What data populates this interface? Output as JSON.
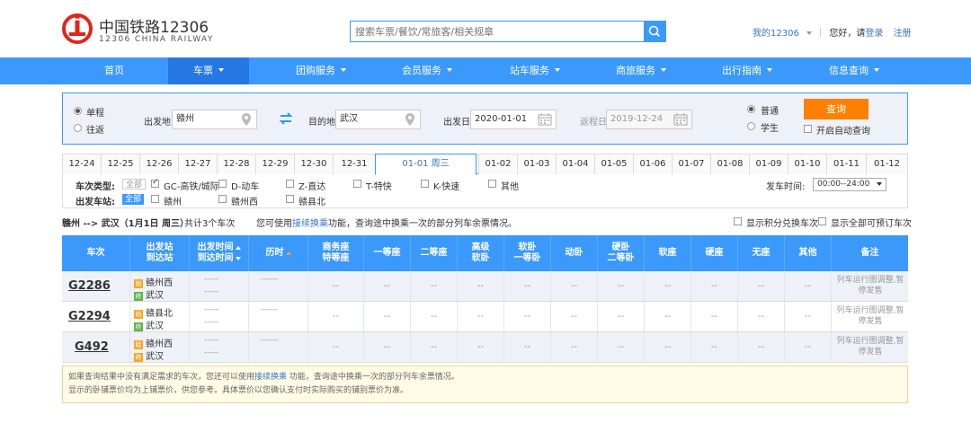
{
  "brand": {
    "name_cn": "中国铁路12306",
    "name_en": "12306 CHINA RAILWAY",
    "color": "#e1251b"
  },
  "search": {
    "placeholder": "搜索车票/餐饮/常旅客/相关规章"
  },
  "top_links": {
    "my12306": "我的12306",
    "greeting": "您好，请",
    "login": "登录",
    "register": "注册"
  },
  "nav": {
    "items": [
      {
        "label": "首页",
        "dropdown": false
      },
      {
        "label": "车票",
        "dropdown": true
      },
      {
        "label": "团购服务",
        "dropdown": true
      },
      {
        "label": "会员服务",
        "dropdown": true
      },
      {
        "label": "站车服务",
        "dropdown": true
      },
      {
        "label": "商旅服务",
        "dropdown": true
      },
      {
        "label": "出行指南",
        "dropdown": true
      },
      {
        "label": "信息查询",
        "dropdown": true
      }
    ]
  },
  "query": {
    "trip_oneway": "单程",
    "trip_round": "往返",
    "from_label": "出发地",
    "from_value": "赣州",
    "to_label": "目的地",
    "to_value": "武汉",
    "depart_label": "出发日",
    "depart_value": "2020-01-01",
    "return_label": "返程日",
    "return_value": "2019-12-24",
    "type_normal": "普通",
    "type_student": "学生",
    "query_btn": "查询",
    "auto_query": "开启自动查询"
  },
  "dates": [
    "12-24",
    "12-25",
    "12-26",
    "12-27",
    "12-28",
    "12-29",
    "12-30",
    "12-31",
    "01-01 周三",
    "01-02",
    "01-03",
    "01-04",
    "01-05",
    "01-06",
    "01-07",
    "01-08",
    "01-09",
    "01-10",
    "01-11",
    "01-12"
  ],
  "filters": {
    "type_label": "车次类型:",
    "station_label": "出发车站:",
    "all": "全部",
    "types": [
      "GC-高铁/城际",
      "D-动车",
      "Z-直达",
      "T-特快",
      "K-快速",
      "其他"
    ],
    "stations": [
      "赣州",
      "赣州西",
      "赣县北"
    ],
    "depart_time_label": "发车时间:",
    "depart_time_value": "00:00--24:00"
  },
  "summary": {
    "route": "赣州 --> 武汉（1月1日 周三）",
    "count": "共计3个车次",
    "hint_pre": "您可使用",
    "hint_link": "接续换乘",
    "hint_post": "功能，查询途中换乘一次的部分列车余票情况。",
    "opt1": "显示积分兑换车次",
    "opt2": "显示全部可预订车次"
  },
  "table": {
    "headers": [
      {
        "l1": "车次",
        "l2": ""
      },
      {
        "l1": "出发站",
        "l2": "到达站"
      },
      {
        "l1": "出发时间",
        "l2": "到达时间"
      },
      {
        "l1": "历时",
        "l2": ""
      },
      {
        "l1": "商务座",
        "l2": "特等座"
      },
      {
        "l1": "一等座",
        "l2": ""
      },
      {
        "l1": "二等座",
        "l2": ""
      },
      {
        "l1": "高级",
        "l2": "软卧"
      },
      {
        "l1": "软卧",
        "l2": "一等卧"
      },
      {
        "l1": "动卧",
        "l2": ""
      },
      {
        "l1": "硬卧",
        "l2": "二等卧"
      },
      {
        "l1": "软座",
        "l2": ""
      },
      {
        "l1": "硬座",
        "l2": ""
      },
      {
        "l1": "无座",
        "l2": ""
      },
      {
        "l1": "其他",
        "l2": ""
      },
      {
        "l1": "备注",
        "l2": ""
      }
    ],
    "rows": [
      {
        "train": "G2286",
        "from": "赣州西",
        "to": "武汉",
        "time_dep": "-----",
        "time_arr": "-----",
        "duration": "------",
        "seat": "--",
        "note": "列车运行图调整,暂停发售"
      },
      {
        "train": "G2294",
        "from": "赣县北",
        "to": "武汉",
        "time_dep": "-----",
        "time_arr": "-----",
        "duration": "------",
        "seat": "--",
        "note": "列车运行图调整,暂停发售"
      },
      {
        "train": "G492",
        "from": "赣州西",
        "to": "武汉",
        "time_dep": "-----",
        "time_arr": "-----",
        "duration": "------",
        "seat": "--",
        "note": "列车运行图调整,暂停发售"
      }
    ],
    "badge_start": "始",
    "badge_end": "终"
  },
  "tip": {
    "line1_pre": "如果查询结果中没有满足需求的车次，您还可以使用",
    "line1_link": "接续换乘",
    "line1_post": " 功能，查询途中换乘一次的部分列车余票情况。",
    "line2": "显示的卧铺票价均为上铺票价，供您参考。具体票价以您确认支付时实际购买的铺别票价为准。"
  }
}
